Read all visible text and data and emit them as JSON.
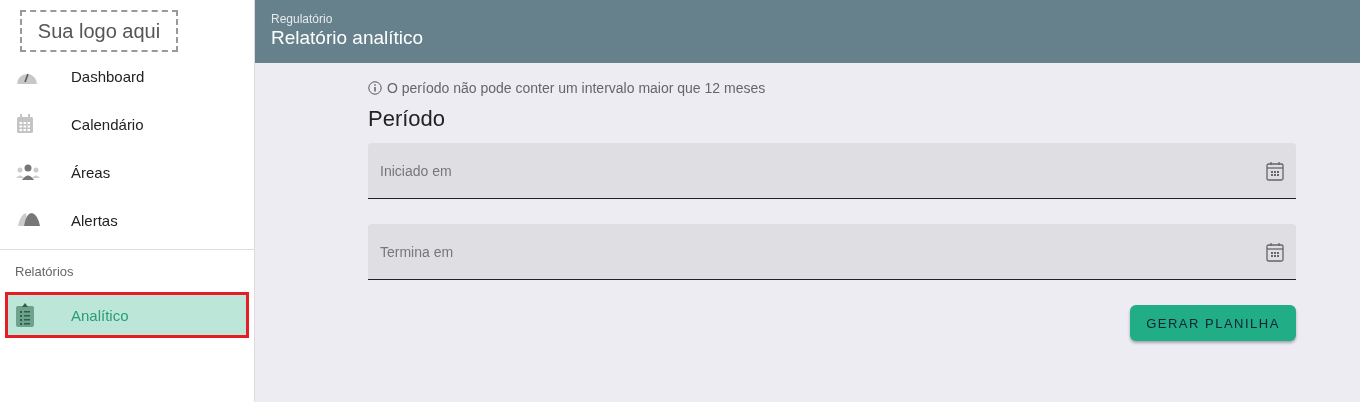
{
  "sidebar": {
    "logo": "Sua logo aqui",
    "items": [
      {
        "label": "Dashboard",
        "selected": false
      },
      {
        "label": "Calendário",
        "selected": false
      },
      {
        "label": "Áreas",
        "selected": false
      },
      {
        "label": "Alertas",
        "selected": false
      }
    ],
    "section": "Relatórios",
    "section_items": [
      {
        "label": "Analítico",
        "selected": true,
        "annotated": true
      }
    ]
  },
  "header": {
    "breadcrumb": "Regulatório",
    "title": "Relatório analítico"
  },
  "notice": "O período não pode conter um intervalo maior que 12 meses",
  "form": {
    "title": "Período",
    "fields": [
      {
        "placeholder": "Iniciado em"
      },
      {
        "placeholder": "Termina em"
      }
    ],
    "button": "GERAR PLANILHA"
  }
}
